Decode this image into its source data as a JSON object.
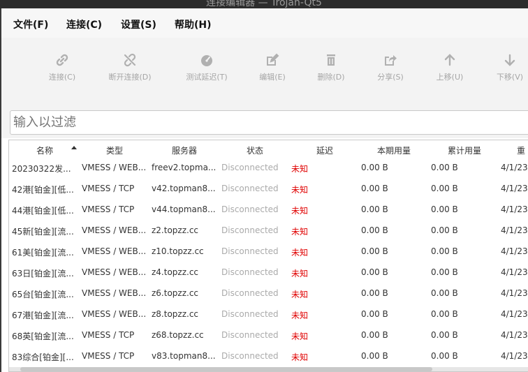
{
  "window": {
    "title": "连接编辑器 — Trojan-Qt5"
  },
  "menu": [
    "文件(F)",
    "连接(C)",
    "设置(S)",
    "帮助(H)"
  ],
  "toolbar": [
    {
      "icon": "link-icon",
      "label": "连接(C)"
    },
    {
      "icon": "unlink-icon",
      "label": "断开连接(D)"
    },
    {
      "icon": "gauge-icon",
      "label": "测试延迟(T)"
    },
    {
      "icon": "edit-icon",
      "label": "编辑(E)"
    },
    {
      "icon": "trash-icon",
      "label": "删除(D)"
    },
    {
      "icon": "share-icon",
      "label": "分享(S)"
    },
    {
      "icon": "arrow-up-icon",
      "label": "上移(U)"
    },
    {
      "icon": "arrow-down-icon",
      "label": "下移(V)"
    }
  ],
  "filter": {
    "placeholder": "输入以过滤"
  },
  "table": {
    "headers": [
      "名称",
      "类型",
      "服务器",
      "状态",
      "延迟",
      "本期用量",
      "累计用量",
      "重"
    ],
    "rows": [
      [
        "20230322发...",
        "VMESS / WEB...",
        "freev2.topma...",
        "Disconnected",
        "未知",
        "0.00  B",
        "0.00  B",
        "4/1/23"
      ],
      [
        "42港[铂金][低...",
        "VMESS / TCP",
        "v42.topman8...",
        "Disconnected",
        "未知",
        "0.00  B",
        "0.00  B",
        "4/1/23"
      ],
      [
        "44港[铂金][低...",
        "VMESS / TCP",
        "v44.topman8...",
        "Disconnected",
        "未知",
        "0.00  B",
        "0.00  B",
        "4/1/23"
      ],
      [
        "45新[铂金][流...",
        "VMESS / WEB...",
        "z2.topzz.cc",
        "Disconnected",
        "未知",
        "0.00  B",
        "0.00  B",
        "4/1/23"
      ],
      [
        "61美[铂金][流...",
        "VMESS / WEB...",
        "z10.topzz.cc",
        "Disconnected",
        "未知",
        "0.00  B",
        "0.00  B",
        "4/1/23"
      ],
      [
        "63日[铂金][流...",
        "VMESS / WEB...",
        "z4.topzz.cc",
        "Disconnected",
        "未知",
        "0.00  B",
        "0.00  B",
        "4/1/23"
      ],
      [
        "65台[铂金][流...",
        "VMESS / WEB...",
        "z6.topzz.cc",
        "Disconnected",
        "未知",
        "0.00  B",
        "0.00  B",
        "4/1/23"
      ],
      [
        "67港[铂金][流...",
        "VMESS / WEB...",
        "z8.topzz.cc",
        "Disconnected",
        "未知",
        "0.00  B",
        "0.00  B",
        "4/1/23"
      ],
      [
        "68英[铂金][流...",
        "VMESS / TCP",
        "z68.topzz.cc",
        "Disconnected",
        "未知",
        "0.00  B",
        "0.00  B",
        "4/1/23"
      ],
      [
        "83综合[铂金][...",
        "VMESS / TCP",
        "v83.topman8...",
        "Disconnected",
        "未知",
        "0.00  B",
        "0.00  B",
        "4/1/23"
      ]
    ]
  },
  "colors": {
    "latency_unknown": "#e00000",
    "status_text": "#aaaaaa",
    "toolbar_disabled": "#a5a5a5"
  }
}
